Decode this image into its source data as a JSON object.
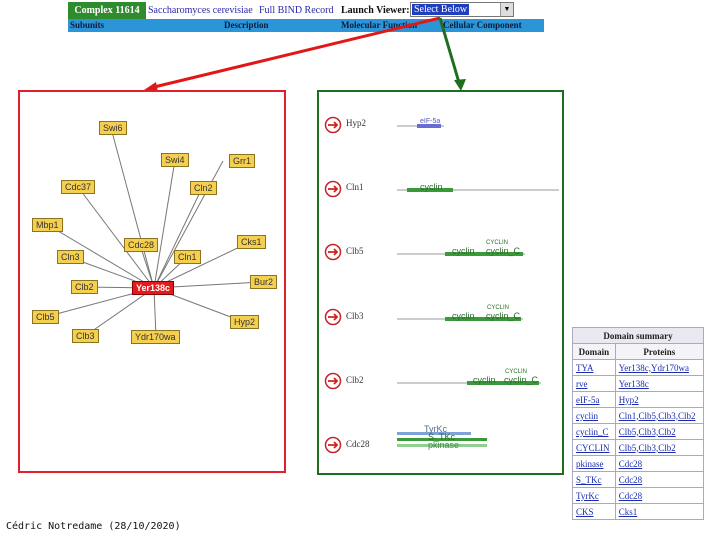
{
  "toolbar": {
    "complex_label": "Complex 11614",
    "organism": "Saccharomyces cerevisiae",
    "full_record": "Full BIND Record",
    "launch_label": "Launch Viewer:",
    "viewer_select": "Select Below"
  },
  "tabs": [
    "Subunits",
    "Description",
    "Molecular Function",
    "Cellular Component"
  ],
  "network": {
    "center": "Yer138c",
    "nodes": [
      "Swi6",
      "Swi4",
      "Grr1",
      "Cdc37",
      "Cln2",
      "Mbp1",
      "Cdc28",
      "Cks1",
      "Cln3",
      "Cln1",
      "Clb2",
      "Bur2",
      "Clb5",
      "Hyp2",
      "Clb3",
      "Ydr170wa"
    ]
  },
  "domains": [
    {
      "protein": "Hyp2",
      "labels": [
        "eIF-5a"
      ]
    },
    {
      "protein": "Cln1",
      "labels": [
        "cyclin"
      ]
    },
    {
      "protein": "Clb5",
      "labels": [
        "cyclin",
        "cyclin_C",
        "CYCLIN"
      ]
    },
    {
      "protein": "Clb3",
      "labels": [
        "cyclin",
        "cyclin_C",
        "CYCLIN"
      ]
    },
    {
      "protein": "Clb2",
      "labels": [
        "cyclin",
        "cyclin_C",
        "CYCLIN"
      ]
    },
    {
      "protein": "Cdc28",
      "labels": [
        "TyrKc",
        "S_TKc",
        "pkinase"
      ]
    }
  ],
  "summary": {
    "title": "Domain summary",
    "col_domain": "Domain",
    "col_proteins": "Proteins",
    "rows": [
      {
        "domain": "TYA",
        "proteins": "Yer138c,Ydr170wa"
      },
      {
        "domain": "rve",
        "proteins": "Yer138c"
      },
      {
        "domain": "eIF-5a",
        "proteins": "Hyp2"
      },
      {
        "domain": "cyclin",
        "proteins": "Cln1,Clb5,Clb3,Clb2"
      },
      {
        "domain": "cyclin_C",
        "proteins": "Clb5,Clb3,Clb2"
      },
      {
        "domain": "CYCLIN",
        "proteins": "Clb5,Clb3,Clb2"
      },
      {
        "domain": "pkinase",
        "proteins": "Cdc28"
      },
      {
        "domain": "S_TKc",
        "proteins": "Cdc28"
      },
      {
        "domain": "TyrKc",
        "proteins": "Cdc28"
      },
      {
        "domain": "CKS",
        "proteins": "Cks1"
      }
    ]
  },
  "credit": "Cédric Notredame (28/10/2020)",
  "colors": {
    "red_frame": "#e0202a",
    "green_frame": "#1f6d1f",
    "node": "#f5cf4f",
    "center": "#e41a1c"
  }
}
